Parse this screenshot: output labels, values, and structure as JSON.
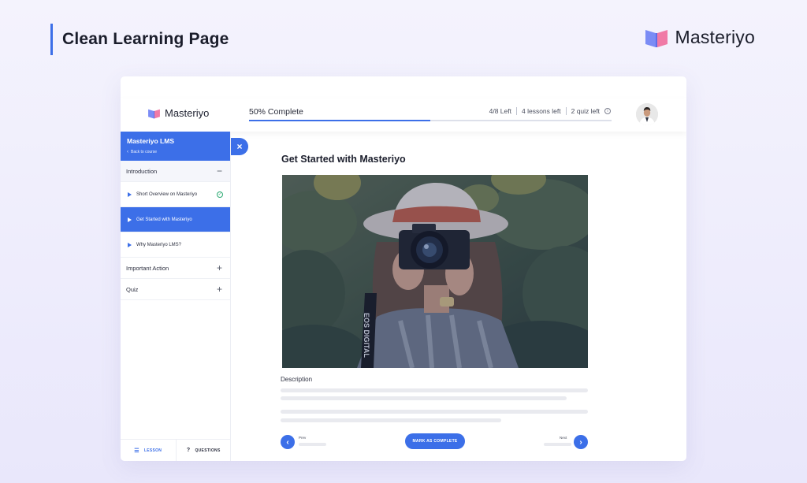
{
  "page": {
    "title": "Clean Learning Page",
    "brand": "Masteriyo"
  },
  "topbar": {
    "brand": "Masteriyo",
    "progress_label": "50% Complete",
    "progress_value": 0.5,
    "stats": [
      "4/8 Left",
      "4 lessons left",
      "2 quiz left"
    ]
  },
  "sidebar": {
    "course_title": "Masteriyo LMS",
    "back_label": "Back to course",
    "sections": [
      {
        "label": "Introduction",
        "toggle": "−",
        "lessons": [
          {
            "label": "Short Overview on Masteriyo",
            "completed": true
          },
          {
            "label": "Get Started with Masteriyo",
            "active": true
          },
          {
            "label": "Why Masteriyo LMS?"
          }
        ]
      },
      {
        "label": "Important Action",
        "toggle": "+"
      },
      {
        "label": "Quiz",
        "toggle": "+"
      }
    ],
    "footer": {
      "lesson": "LESSON",
      "questions": "QUESTIONS"
    }
  },
  "content": {
    "title": "Get Started with Masteriyo",
    "description_label": "Description",
    "camera_text": "EOS DIGITAL",
    "prev_label": "Prev",
    "next_label": "Next",
    "mark_complete": "MARK AS COMPLETE"
  },
  "colors": {
    "accent": "#3c6fe8",
    "success": "#2aa971"
  }
}
